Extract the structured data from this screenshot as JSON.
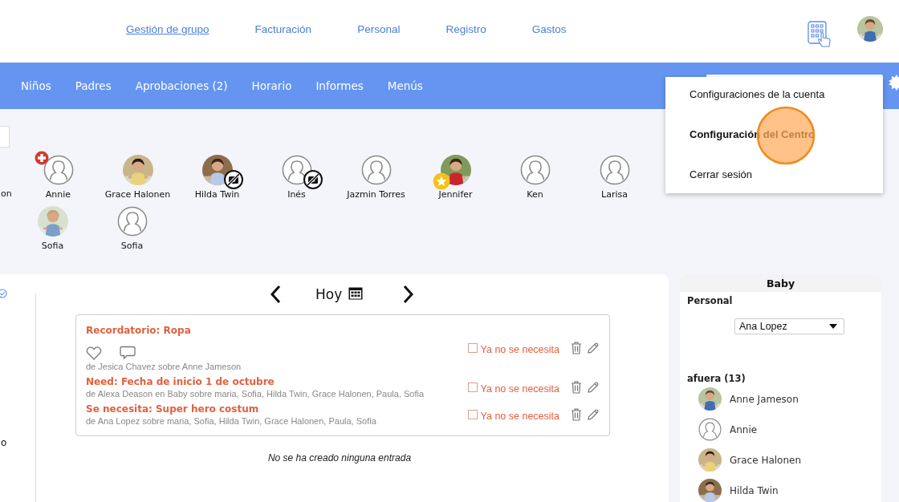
{
  "header": {
    "nav": [
      {
        "label": "Gestión de grupo",
        "selected": true
      },
      {
        "label": "Facturación",
        "selected": false
      },
      {
        "label": "Personal",
        "selected": false
      },
      {
        "label": "Registro",
        "selected": false
      },
      {
        "label": "Gastos",
        "selected": false
      }
    ]
  },
  "tabs": [
    {
      "label": "Niños"
    },
    {
      "label": "Padres"
    },
    {
      "label": "Aprobaciones (2)"
    },
    {
      "label": "Horario"
    },
    {
      "label": "Informes"
    },
    {
      "label": "Menús"
    }
  ],
  "account_menu": {
    "items": [
      {
        "label": "Configuraciones de la cuenta",
        "selected": false
      },
      {
        "label": "Configuración del Centro",
        "selected": true
      },
      {
        "label": "Cerrar sesión",
        "selected": false
      }
    ]
  },
  "children": {
    "leading_name_fragment": "on",
    "rows": [
      [
        {
          "name": "Annie",
          "avatar": {
            "kind": "placeholder"
          },
          "badge": {
            "kind": "medical"
          }
        },
        {
          "name": "Grace Halonen"
        },
        {
          "name": "Hilda Twin",
          "badge": {
            "kind": "no-photo"
          }
        },
        {
          "name": "Inés",
          "avatar": {
            "kind": "placeholder"
          },
          "badge": {
            "kind": "no-photo"
          }
        },
        {
          "name": "Jazmin Torres",
          "avatar": {
            "kind": "placeholder"
          }
        },
        {
          "name": "Jennifer",
          "badge": {
            "kind": "star"
          }
        },
        {
          "name": "Ken",
          "avatar": {
            "kind": "placeholder"
          }
        },
        {
          "name": "Larisa",
          "avatar": {
            "kind": "placeholder"
          }
        }
      ],
      [
        {
          "name": "Sofia"
        },
        {
          "name": "Sofia",
          "avatar": {
            "kind": "placeholder"
          }
        }
      ]
    ]
  },
  "left_column": {
    "text_fragment": "o"
  },
  "date_nav": {
    "label": "Hoy"
  },
  "notes": [
    {
      "title": "Recordatorio: Ropa",
      "reactions": true,
      "meta": "de Jesica Chavez sobre Anne Jameson",
      "checked": false,
      "action": "Ya no se necesita"
    },
    {
      "title": "Need: Fecha de inicio 1 de octubre",
      "reactions": false,
      "meta": "de Alexa Deason en Baby sobre maria, Sofia, Hilda Twin, Grace Halonen, Paula, Sofia",
      "checked": false,
      "action": "Ya no se necesita"
    },
    {
      "title": "Se necesita: Super hero costum",
      "reactions": false,
      "meta": "de Ana Lopez sobre maria, Sofia, Hilda Twin, Grace Halonen, Paula, Sofia",
      "checked": false,
      "action": "Ya no se necesita"
    }
  ],
  "empty_message": "No se ha creado ninguna entrada",
  "room_panel": {
    "title": "Baby",
    "staff_label": "Personal",
    "staff_value": "Ana Lopez",
    "group_label": "afuera (13)",
    "children": [
      {
        "name": "Anne Jameson"
      },
      {
        "name": "Annie",
        "avatar": {
          "kind": "placeholder"
        }
      },
      {
        "name": "Grace Halonen"
      },
      {
        "name": "Hilda Twin"
      }
    ]
  }
}
